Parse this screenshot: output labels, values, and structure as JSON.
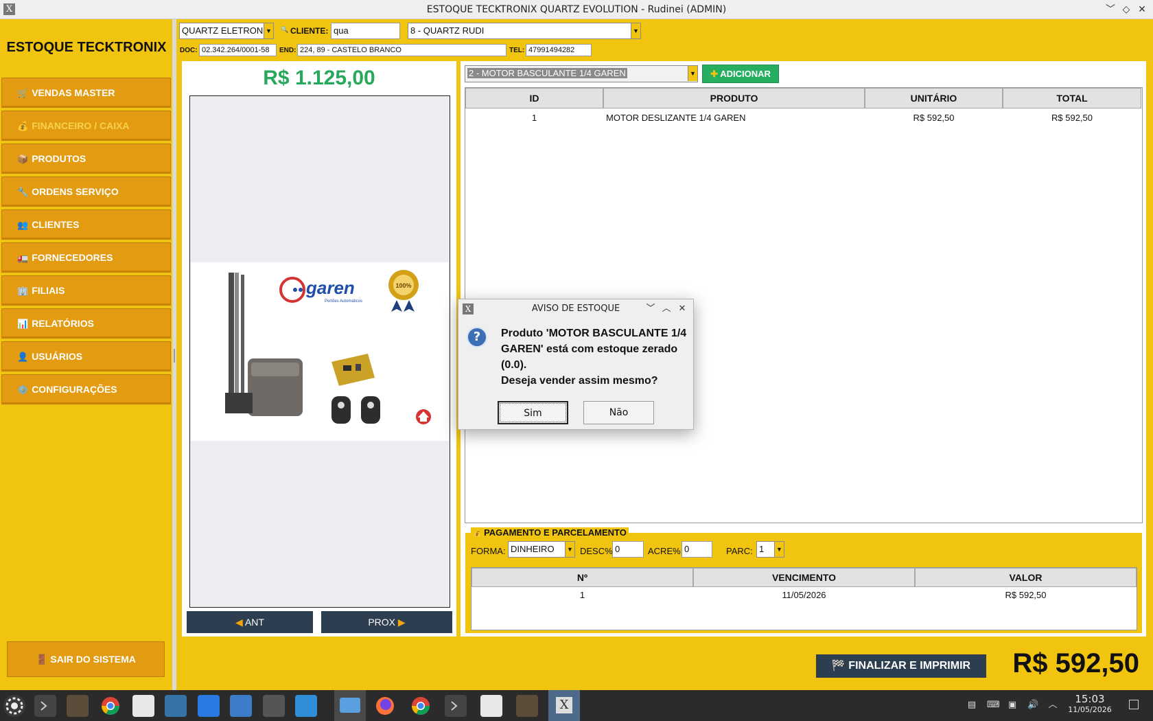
{
  "window": {
    "title": "ESTOQUE TECKTRONIX QUARTZ EVOLUTION - Rudinei (ADMIN)",
    "controls": [
      "minimize",
      "maximize",
      "close"
    ]
  },
  "sidebar": {
    "brand": "ESTOQUE TECKTRONIX",
    "items": [
      {
        "label": "VENDAS MASTER",
        "icon": "cart-icon",
        "glyph": "🛒",
        "active": false
      },
      {
        "label": "FINANCEIRO / CAIXA",
        "icon": "money-bag-icon",
        "glyph": "💰",
        "active": true
      },
      {
        "label": "PRODUTOS",
        "icon": "package-icon",
        "glyph": "📦",
        "active": false
      },
      {
        "label": "ORDENS SERVIÇO",
        "icon": "wrench-icon",
        "glyph": "🔧",
        "active": false
      },
      {
        "label": "CLIENTES",
        "icon": "people-icon",
        "glyph": "👥",
        "active": false
      },
      {
        "label": "FORNECEDORES",
        "icon": "truck-icon",
        "glyph": "🚛",
        "active": false
      },
      {
        "label": "FILIAIS",
        "icon": "building-icon",
        "glyph": "🏢",
        "active": false
      },
      {
        "label": "RELATÓRIOS",
        "icon": "bar-chart-icon",
        "glyph": "📊",
        "active": false
      },
      {
        "label": "USUÁRIOS",
        "icon": "user-icon",
        "glyph": "👤",
        "active": false
      },
      {
        "label": "CONFIGURAÇÕES",
        "icon": "gear-icon",
        "glyph": "⚙️",
        "active": false
      }
    ],
    "exit": {
      "label": "SAIR DO SISTEMA",
      "icon": "door-icon",
      "glyph": "🚪"
    }
  },
  "header": {
    "company_select": "QUARTZ ELETRONIC",
    "client_label": "CLIENTE:",
    "client_search": "qua",
    "client_select": "8 - QUARTZ RUDI",
    "doc_label": "DOC:",
    "doc_value": "02.342.264/0001-58",
    "end_label": "END:",
    "end_value": "224, 89 - CASTELO BRANCO",
    "tel_label": "TEL:",
    "tel_value": "47991494282"
  },
  "preview": {
    "total": "R$ 1.125,00",
    "brand_logo_text": "garen",
    "brand_tagline": "Portões Automáticos",
    "seal_text": "100%",
    "prev_button": "ANT",
    "next_button": "PROX"
  },
  "cart": {
    "product_select": "2 - MOTOR BASCULANTE 1/4 GAREN",
    "add_button": "ADICIONAR",
    "columns": [
      "ID",
      "PRODUTO",
      "UNITÁRIO",
      "TOTAL"
    ],
    "rows": [
      {
        "id": "1",
        "produto": "MOTOR DESLIZANTE 1/4 GAREN",
        "unitario": "R$ 592,50",
        "total": "R$ 592,50"
      }
    ]
  },
  "payment": {
    "title": "PAGAMENTO E PARCELAMENTO",
    "forma_label": "FORMA:",
    "forma_value": "DINHEIRO",
    "desc_label": "DESC%:",
    "desc_value": "0",
    "acre_label": "ACRE%:",
    "acre_value": "0",
    "parc_label": "PARC:",
    "parc_value": "1",
    "columns": [
      "Nº",
      "VENCIMENTO",
      "VALOR"
    ],
    "rows": [
      {
        "n": "1",
        "vencimento": "11/05/2026",
        "valor": "R$ 592,50"
      }
    ]
  },
  "footer": {
    "finalize_button": "FINALIZAR E IMPRIMIR",
    "total": "R$ 592,50"
  },
  "dialog": {
    "title": "AVISO DE ESTOQUE",
    "message_lines": [
      "Produto 'MOTOR BASCULANTE 1/4",
      "GAREN' está com estoque zerado",
      "(0.0).",
      "Deseja vender assim mesmo?"
    ],
    "yes_button": "Sim",
    "no_button": "Não"
  },
  "taskbar": {
    "time": "15:03",
    "date": "11/05/2026"
  },
  "colors": {
    "background": "#f1c40f",
    "menu_button": "#e39b12",
    "accent_green": "#27a85d",
    "dark_button": "#2c3e50"
  }
}
